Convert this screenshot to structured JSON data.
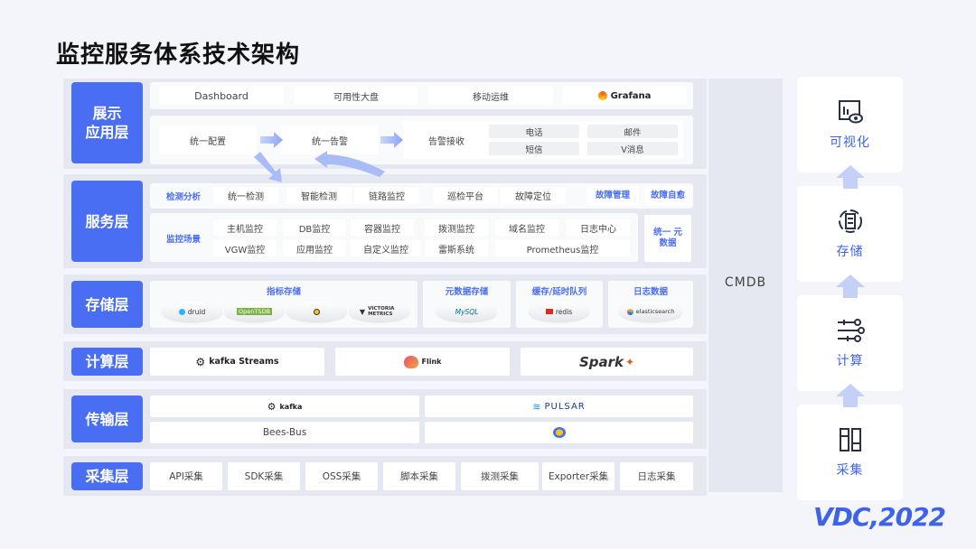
{
  "title": "监控服务体系技术架构",
  "cmdb": "CMDB",
  "layers": {
    "display": [
      "展示",
      "应用层"
    ],
    "service": "服务层",
    "storage": "存储层",
    "compute": "计算层",
    "transport": "传输层",
    "collect": "采集层"
  },
  "display": {
    "top": [
      "Dashboard",
      "可用性大盘",
      "移动运维",
      "Grafana"
    ],
    "flow": [
      "统一配置",
      "统一告警",
      "告警接收"
    ],
    "channels": [
      "电话",
      "邮件",
      "短信",
      "V消息"
    ]
  },
  "service": {
    "detect_tag": "检测分析",
    "detect": [
      "统一检测",
      "智能检测",
      "链路监控",
      "巡检平台",
      "故障定位"
    ],
    "fault_mgmt": "故障管理",
    "fault_heal": "故障自愈",
    "scene_tag": "监控场景",
    "scenes_row1": [
      "主机监控",
      "DB监控",
      "容器监控",
      "拨测监控",
      "域名监控",
      "日志中心"
    ],
    "scenes_row2": [
      "VGW监控",
      "应用监控",
      "自定义监控",
      "雷斯系统",
      "Prometheus监控"
    ],
    "meta": "统一 元数据"
  },
  "storage": {
    "groups": [
      "指标存储",
      "元数据存储",
      "缓存/延时队列",
      "日志数据"
    ],
    "metric_logos": [
      "druid",
      "OpenTSDB",
      "",
      "VICTORIA METRICS"
    ],
    "meta_logo": "MySQL",
    "cache_logo": "redis",
    "log_logo": "elasticsearch"
  },
  "compute": [
    "kafka Streams",
    "Flink",
    "Spark"
  ],
  "transport": {
    "kafka": "kafka",
    "pulsar": "PULSAR",
    "bees": "Bees-Bus"
  },
  "collect": [
    "API采集",
    "SDK采集",
    "OSS采集",
    "脚本采集",
    "拨测采集",
    "Exporter采集",
    "日志采集"
  ],
  "right": [
    "可视化",
    "存储",
    "计算",
    "采集"
  ],
  "brand": "VDC,2022",
  "colors": {
    "accent": "#4a6ef3",
    "arrow": "#9fb3f7"
  }
}
